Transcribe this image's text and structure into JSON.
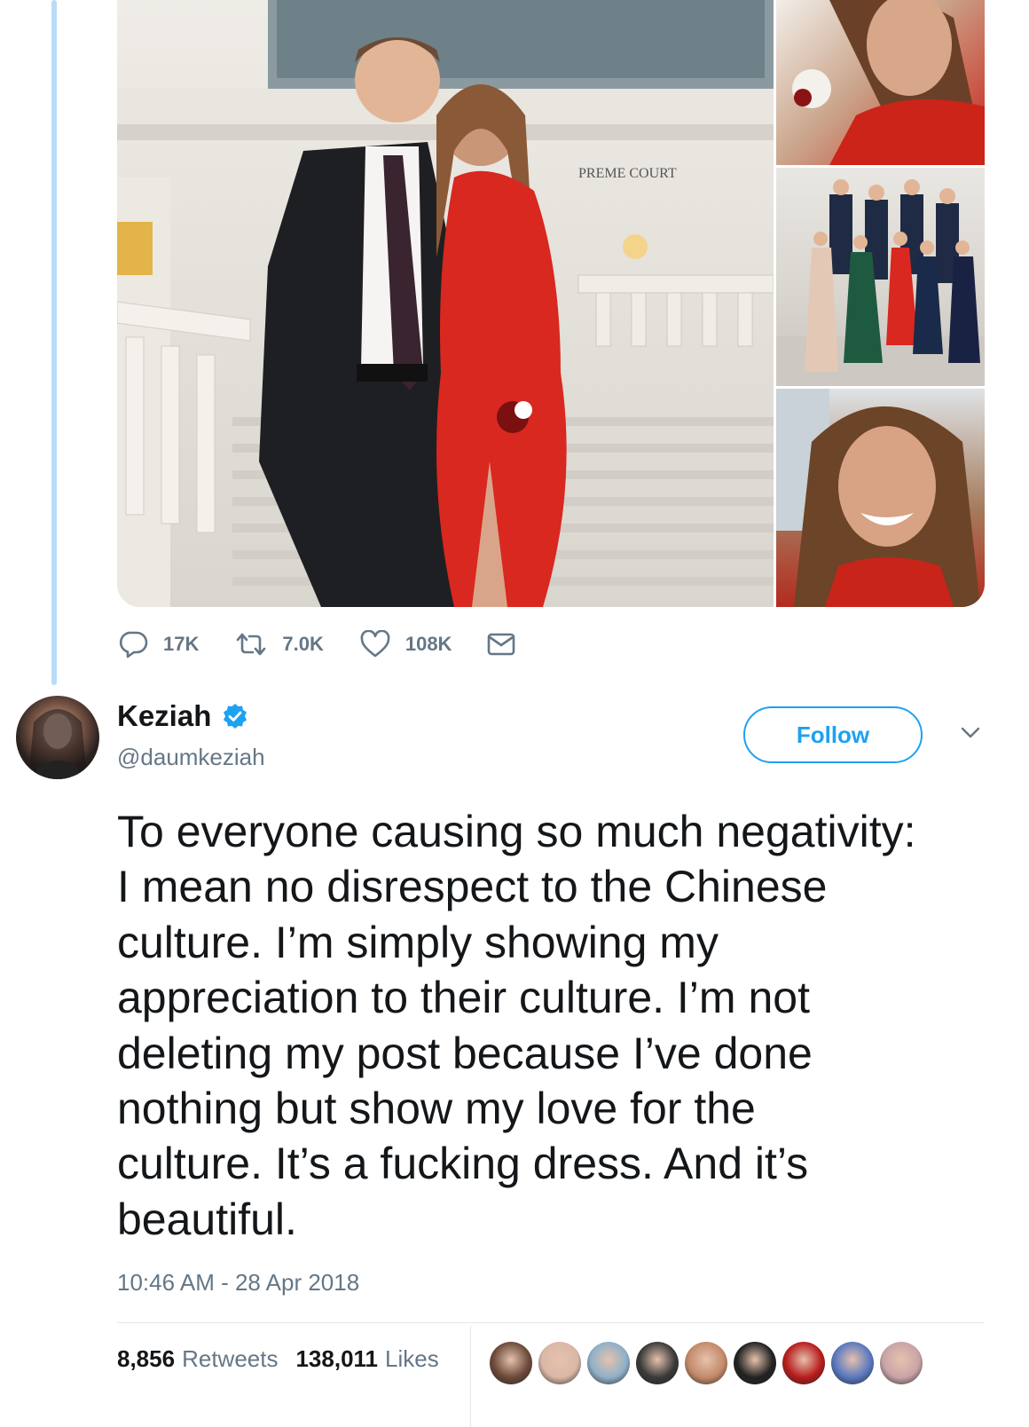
{
  "tweet_actions": {
    "replies": "17K",
    "retweets": "7.0K",
    "likes": "108K"
  },
  "author": {
    "name": "Keziah",
    "handle": "@daumkeziah",
    "verified": true
  },
  "follow_label": "Follow",
  "tweet": {
    "text": "To everyone causing so much negativity:\nI mean no disrespect to the Chinese\nculture. I’m simply showing my\nappreciation to their culture. I’m not\ndeleting my post because I’ve done\nnothing but show my love for the\nculture. It’s a fucking dress. And it’s\nbeautiful.",
    "timestamp": "10:46 AM - 28 Apr 2018"
  },
  "stats": {
    "retweets_count": "8,856",
    "retweets_label": "Retweets",
    "likes_count": "138,011",
    "likes_label": "Likes"
  },
  "photo_sign_text": "PREME COURT",
  "liker_avatar_colors": [
    "#6b4a3a",
    "#d9b8a8",
    "#8fb0c8",
    "#3a3a3a",
    "#c48a6a",
    "#222222",
    "#b81c1c",
    "#5a78c0",
    "#c9a4a8"
  ],
  "colors": {
    "accent": "#1da1f2",
    "muted": "#657786",
    "thread_line": "#b8dcf7",
    "dress_red": "#d8281f"
  }
}
